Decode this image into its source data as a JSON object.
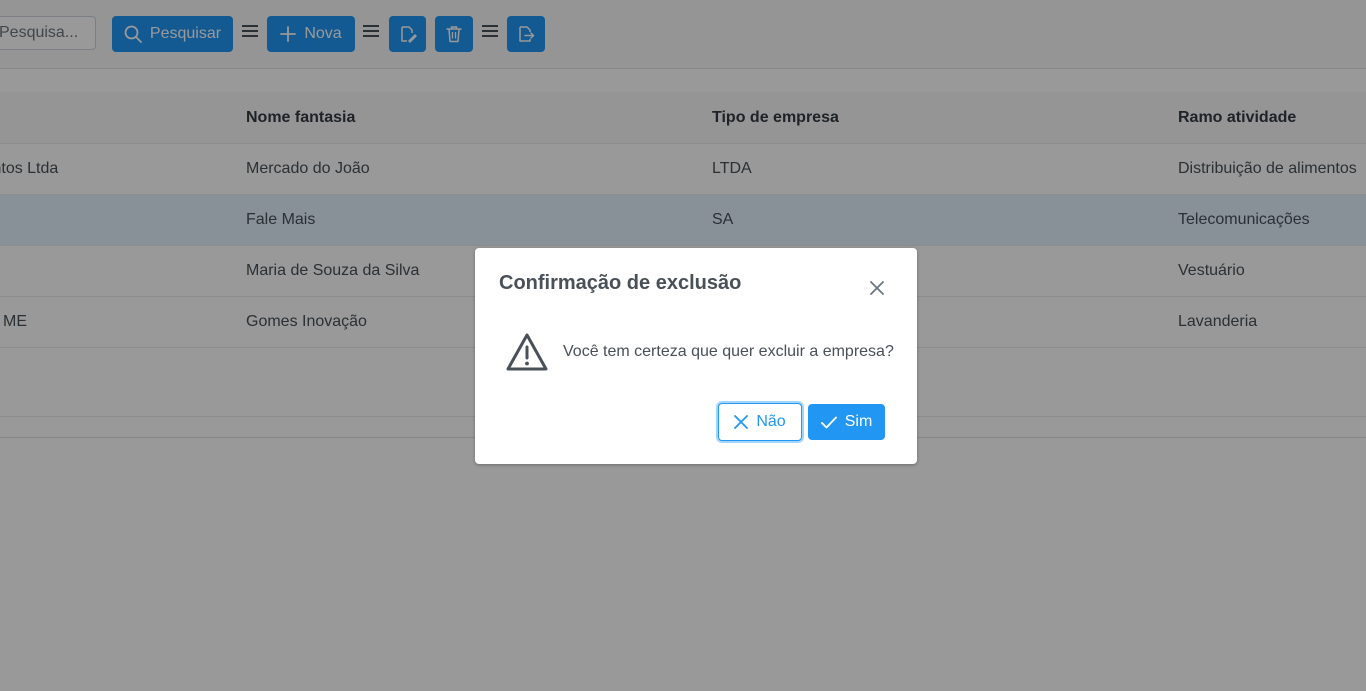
{
  "toolbar": {
    "search_placeholder": "Pesquisa...",
    "search_button_label": "Pesquisar",
    "new_button_label": "Nova",
    "edit_icon": "edit-icon",
    "delete_icon": "trash-icon",
    "export_icon": "export-icon"
  },
  "table": {
    "columns": [
      "",
      "Nome fantasia",
      "Tipo de empresa",
      "Ramo atividade"
    ],
    "rows": [
      {
        "col0": "e Alimentos Ltda",
        "col1": "Mercado do João",
        "col2": "LTDA",
        "col3": "Distribuição de alimentos",
        "selected": false
      },
      {
        "col0": "",
        "col1": "Fale Mais",
        "col2": "SA",
        "col3": "Telecomunicações",
        "selected": true
      },
      {
        "col0": "",
        "col1": "Maria de Souza da Silva",
        "col2": "",
        "col3": "Vestuário",
        "selected": false
      },
      {
        "col0": "ME",
        "col1": "Gomes Inovação",
        "col2": "",
        "col3": "Lavanderia",
        "selected": false
      }
    ]
  },
  "dialog": {
    "title": "Confirmação de exclusão",
    "message": "Você tem certeza que quer excluir a empresa?",
    "no_label": "Não",
    "yes_label": "Sim"
  },
  "colors": {
    "primary": "#2196f3",
    "selected_row": "#e3f2fd",
    "overlay": "rgba(0,0,0,0.4)"
  }
}
